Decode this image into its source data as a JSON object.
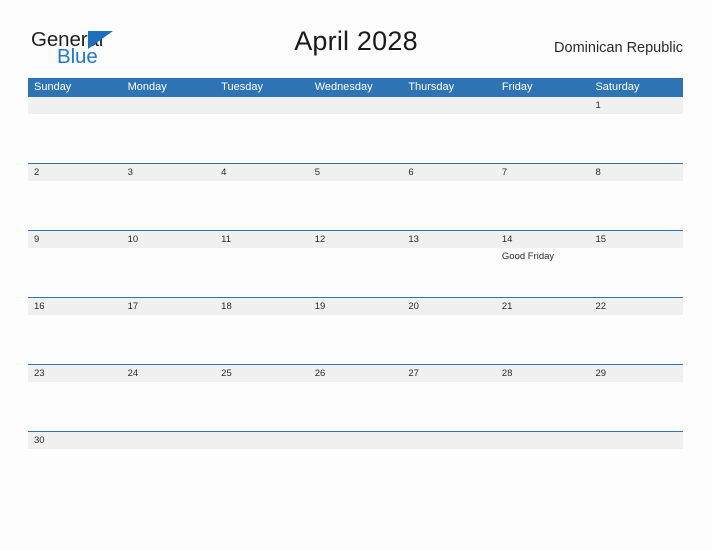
{
  "brand": {
    "name_part1": "General",
    "name_part2": "Blue",
    "triangle_color": "#1e6fbe",
    "text_color": "#231f20",
    "blue_color": "#2277c8"
  },
  "header": {
    "title": "April 2028",
    "country": "Dominican Republic"
  },
  "theme": {
    "header_blue": "#2e74b5",
    "number_band_gray": "#f0f0f0",
    "page_background": "#fdfdfd",
    "text_color": "#2a2a2a"
  },
  "calendar": {
    "weekdays": [
      "Sunday",
      "Monday",
      "Tuesday",
      "Wednesday",
      "Thursday",
      "Friday",
      "Saturday"
    ],
    "weeks": [
      {
        "days": [
          {
            "num": "",
            "events": []
          },
          {
            "num": "",
            "events": []
          },
          {
            "num": "",
            "events": []
          },
          {
            "num": "",
            "events": []
          },
          {
            "num": "",
            "events": []
          },
          {
            "num": "",
            "events": []
          },
          {
            "num": "1",
            "events": []
          }
        ]
      },
      {
        "days": [
          {
            "num": "2",
            "events": []
          },
          {
            "num": "3",
            "events": []
          },
          {
            "num": "4",
            "events": []
          },
          {
            "num": "5",
            "events": []
          },
          {
            "num": "6",
            "events": []
          },
          {
            "num": "7",
            "events": []
          },
          {
            "num": "8",
            "events": []
          }
        ]
      },
      {
        "days": [
          {
            "num": "9",
            "events": []
          },
          {
            "num": "10",
            "events": []
          },
          {
            "num": "11",
            "events": []
          },
          {
            "num": "12",
            "events": []
          },
          {
            "num": "13",
            "events": []
          },
          {
            "num": "14",
            "events": [
              "Good Friday"
            ]
          },
          {
            "num": "15",
            "events": []
          }
        ]
      },
      {
        "days": [
          {
            "num": "16",
            "events": []
          },
          {
            "num": "17",
            "events": []
          },
          {
            "num": "18",
            "events": []
          },
          {
            "num": "19",
            "events": []
          },
          {
            "num": "20",
            "events": []
          },
          {
            "num": "21",
            "events": []
          },
          {
            "num": "22",
            "events": []
          }
        ]
      },
      {
        "days": [
          {
            "num": "23",
            "events": []
          },
          {
            "num": "24",
            "events": []
          },
          {
            "num": "25",
            "events": []
          },
          {
            "num": "26",
            "events": []
          },
          {
            "num": "27",
            "events": []
          },
          {
            "num": "28",
            "events": []
          },
          {
            "num": "29",
            "events": []
          }
        ]
      },
      {
        "days": [
          {
            "num": "30",
            "events": []
          },
          {
            "num": "",
            "events": []
          },
          {
            "num": "",
            "events": []
          },
          {
            "num": "",
            "events": []
          },
          {
            "num": "",
            "events": []
          },
          {
            "num": "",
            "events": []
          },
          {
            "num": "",
            "events": []
          }
        ]
      }
    ]
  }
}
